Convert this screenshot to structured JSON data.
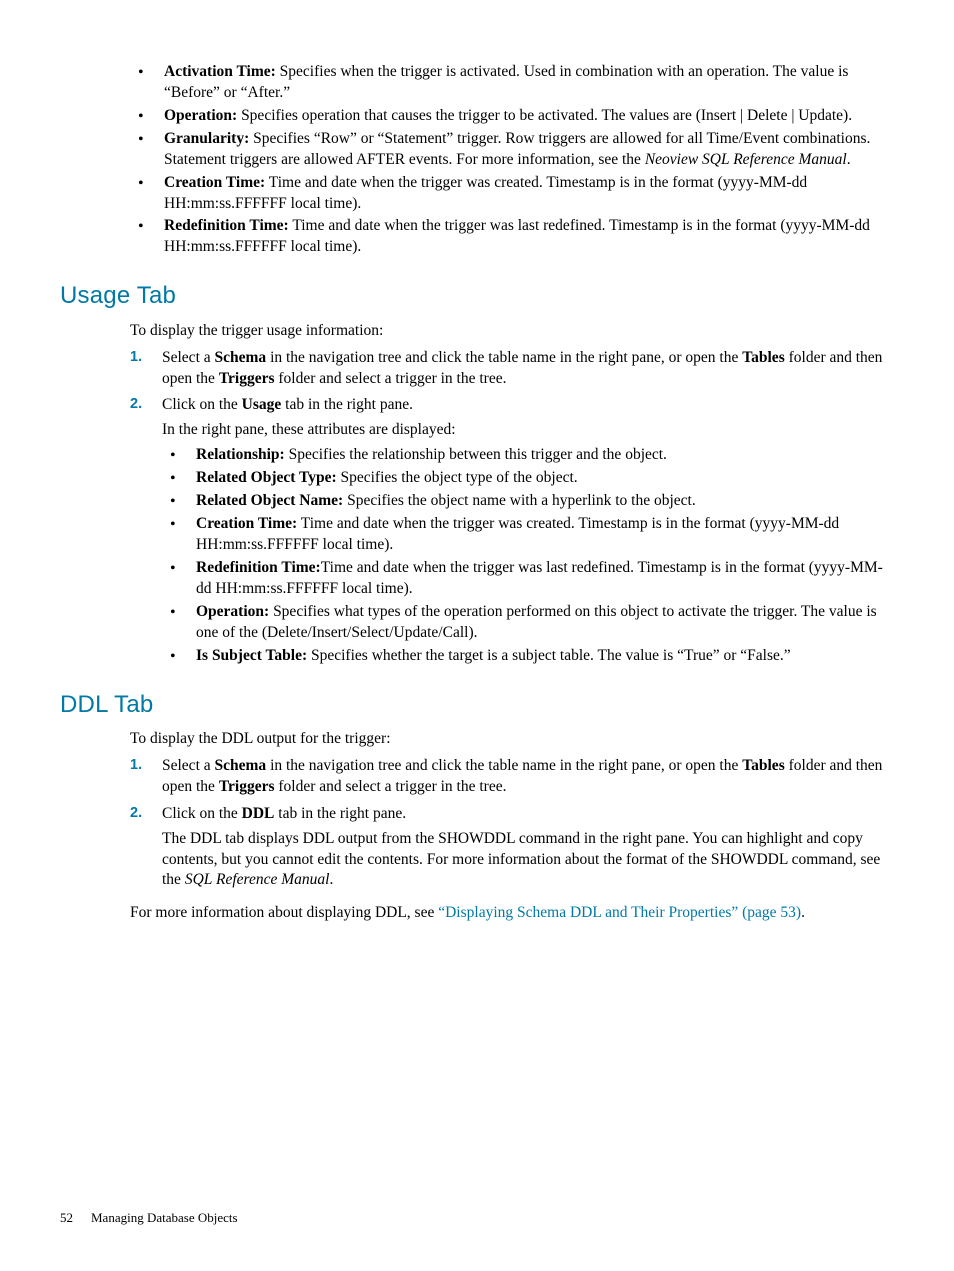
{
  "top_bullets": [
    {
      "term": "Activation Time:",
      "text": " Specifies when the trigger is activated. Used in combination with an operation. The value is “Before” or “After.”"
    },
    {
      "term": "Operation:",
      "text": " Specifies operation that causes the trigger to be activated. The values are (Insert | Delete | Update)."
    },
    {
      "term": "Granularity:",
      "text_before": " Specifies “Row” or “Statement” trigger. Row triggers are allowed for all Time/Event combinations. Statement triggers are allowed AFTER events. For more information, see the ",
      "italic": "Neoview SQL Reference Manual",
      "text_after": "."
    },
    {
      "term": "Creation Time:",
      "text": " Time and date when the trigger was created. Timestamp is in the format (yyyy-MM-dd HH:mm:ss.FFFFFF local time)."
    },
    {
      "term": "Redefinition Time:",
      "text": " Time and date when the trigger was last redefined. Timestamp is in the format (yyyy-MM-dd HH:mm:ss.FFFFFF local time)."
    }
  ],
  "usage": {
    "heading": "Usage Tab",
    "intro": "To display the trigger usage information:",
    "step1": {
      "pre": "Select a ",
      "b1": "Schema",
      "mid1": " in the navigation tree and click the table name in the right pane, or open the ",
      "b2": "Tables",
      "mid2": " folder and then open the ",
      "b3": "Triggers",
      "post": " folder and select a trigger in the tree."
    },
    "step2": {
      "pre": "Click on the ",
      "b1": "Usage",
      "post": " tab in the right pane.",
      "after": "In the right pane, these attributes are displayed:"
    },
    "attributes": [
      {
        "term": "Relationship:",
        "text": " Specifies the relationship between this trigger and the object."
      },
      {
        "term": "Related Object Type:",
        "text": " Specifies the object type of the object."
      },
      {
        "term": "Related Object Name:",
        "text": " Specifies the object name with a hyperlink to the object."
      },
      {
        "term": "Creation Time:",
        "text": " Time and date when the trigger was created. Timestamp is in the format (yyyy-MM-dd HH:mm:ss.FFFFFF local time)."
      },
      {
        "term": "Redefinition Time:",
        "text": "Time and date when the trigger was last redefined. Timestamp is in the format (yyyy-MM-dd HH:mm:ss.FFFFFF local time)."
      },
      {
        "term": "Operation:",
        "text": " Specifies what types of the operation performed on this object to activate the trigger. The value is one of the (Delete/Insert/Select/Update/Call)."
      },
      {
        "term": "Is Subject Table:",
        "text": " Specifies whether the target is a subject table. The value is “True” or “False.”"
      }
    ]
  },
  "ddl": {
    "heading": "DDL Tab",
    "intro": "To display the DDL output for the trigger:",
    "step1": {
      "pre": "Select a ",
      "b1": "Schema",
      "mid1": " in the navigation tree and click the table name in the right pane, or open the ",
      "b2": "Tables",
      "mid2": " folder and then open the ",
      "b3": "Triggers",
      "post": " folder and select a trigger in the tree."
    },
    "step2": {
      "pre": "Click on the ",
      "b1": "DDL",
      "post": " tab in the right pane.",
      "after_pre": "The DDL tab displays DDL output from the SHOWDDL command in the right pane. You can highlight and copy contents, but you cannot edit the contents. For more information about the format of the SHOWDDL command, see the ",
      "after_italic": "SQL Reference Manual",
      "after_post": "."
    },
    "moreinfo": {
      "pre": "For more information about displaying DDL, see ",
      "link": "“Displaying Schema DDL and Their Properties” (page 53)",
      "post": "."
    }
  },
  "footer": {
    "page": "52",
    "title": "Managing Database Objects"
  }
}
